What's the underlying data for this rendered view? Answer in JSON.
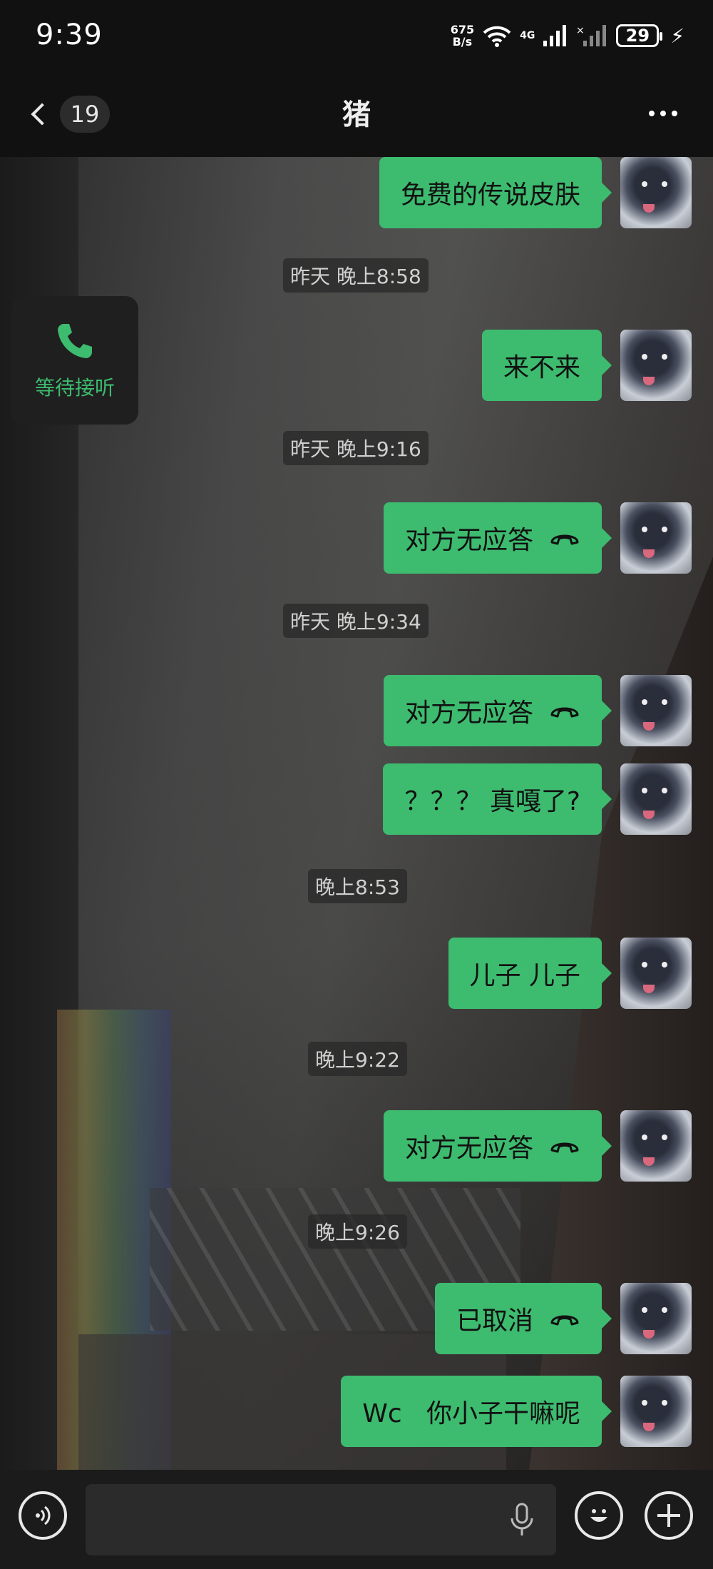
{
  "status_bar": {
    "time": "9:39",
    "net_speed_top": "675",
    "net_speed_bottom": "B/s",
    "signal_label": "4G",
    "battery": "29"
  },
  "header": {
    "unread_count": "19",
    "title": "猪"
  },
  "call_widget": {
    "label": "等待接听"
  },
  "messages": [
    {
      "type": "out",
      "text": "免费的传说皮肤"
    },
    {
      "type": "time",
      "text": "昨天 晚上8:58"
    },
    {
      "type": "out",
      "text": "来不来"
    },
    {
      "type": "time",
      "text": "昨天 晚上9:16"
    },
    {
      "type": "call",
      "text": "对方无应答"
    },
    {
      "type": "time",
      "text": "昨天 晚上9:34"
    },
    {
      "type": "call",
      "text": "对方无应答"
    },
    {
      "type": "out",
      "text": "？？？ 真嘎了?"
    },
    {
      "type": "time",
      "text": "晚上8:53"
    },
    {
      "type": "out",
      "text": "儿子 儿子"
    },
    {
      "type": "time",
      "text": "晚上9:22"
    },
    {
      "type": "call",
      "text": "对方无应答"
    },
    {
      "type": "time",
      "text": "晚上9:26"
    },
    {
      "type": "call",
      "text": "已取消"
    },
    {
      "type": "out",
      "text": "Wc   你小子干嘛呢"
    }
  ],
  "input": {
    "value": "",
    "placeholder": ""
  },
  "colors": {
    "bubble": "#3dbb6f",
    "accent": "#3dbb6f",
    "bar": "#111111"
  },
  "icons": [
    "back-chevron-icon",
    "more-icon",
    "phone-icon",
    "hangup-icon",
    "voice-icon",
    "mic-icon",
    "emoji-icon",
    "plus-icon"
  ]
}
